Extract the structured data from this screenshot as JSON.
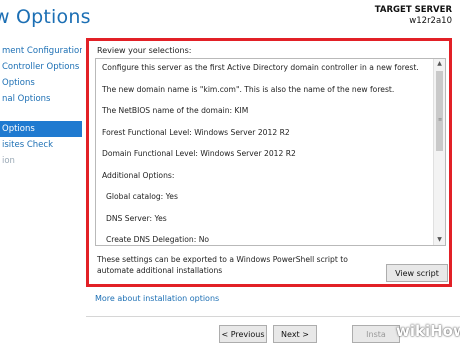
{
  "header": {
    "title": "w Options",
    "server_label": "TARGET SERVER",
    "server_name": "w12r2a10"
  },
  "nav": {
    "items": [
      {
        "label": "ment Configuration",
        "state": "normal"
      },
      {
        "label": "Controller Options",
        "state": "normal"
      },
      {
        "label": "Options",
        "state": "normal"
      },
      {
        "label": "nal Options",
        "state": "normal"
      },
      {
        "label": "Options",
        "state": "active"
      },
      {
        "label": "isites Check",
        "state": "normal"
      },
      {
        "label": "ion",
        "state": "disabled"
      }
    ]
  },
  "review": {
    "label": "Review your selections:",
    "lines": [
      "Configure this server as the first Active Directory domain controller in a new forest.",
      "The new domain name is \"kim.com\". This is also the name of the new forest.",
      "The NetBIOS name of the domain: KIM",
      "Forest Functional Level: Windows Server 2012 R2",
      "Domain Functional Level: Windows Server 2012 R2",
      "Additional Options:",
      "  Global catalog: Yes",
      "  DNS Server: Yes",
      "  Create DNS Delegation: No"
    ]
  },
  "export": {
    "text": "These settings can be exported to a Windows PowerShell script to automate additional installations",
    "view_script_label": "View script"
  },
  "more_link": "More about installation options",
  "footer": {
    "previous_label": "< Previous",
    "next_label": "Next >",
    "install_label": "Insta"
  },
  "watermark": "wikiHow",
  "colors": {
    "accent": "#1f7ad0",
    "link": "#1c6fb4",
    "highlight_border": "#e22026"
  }
}
